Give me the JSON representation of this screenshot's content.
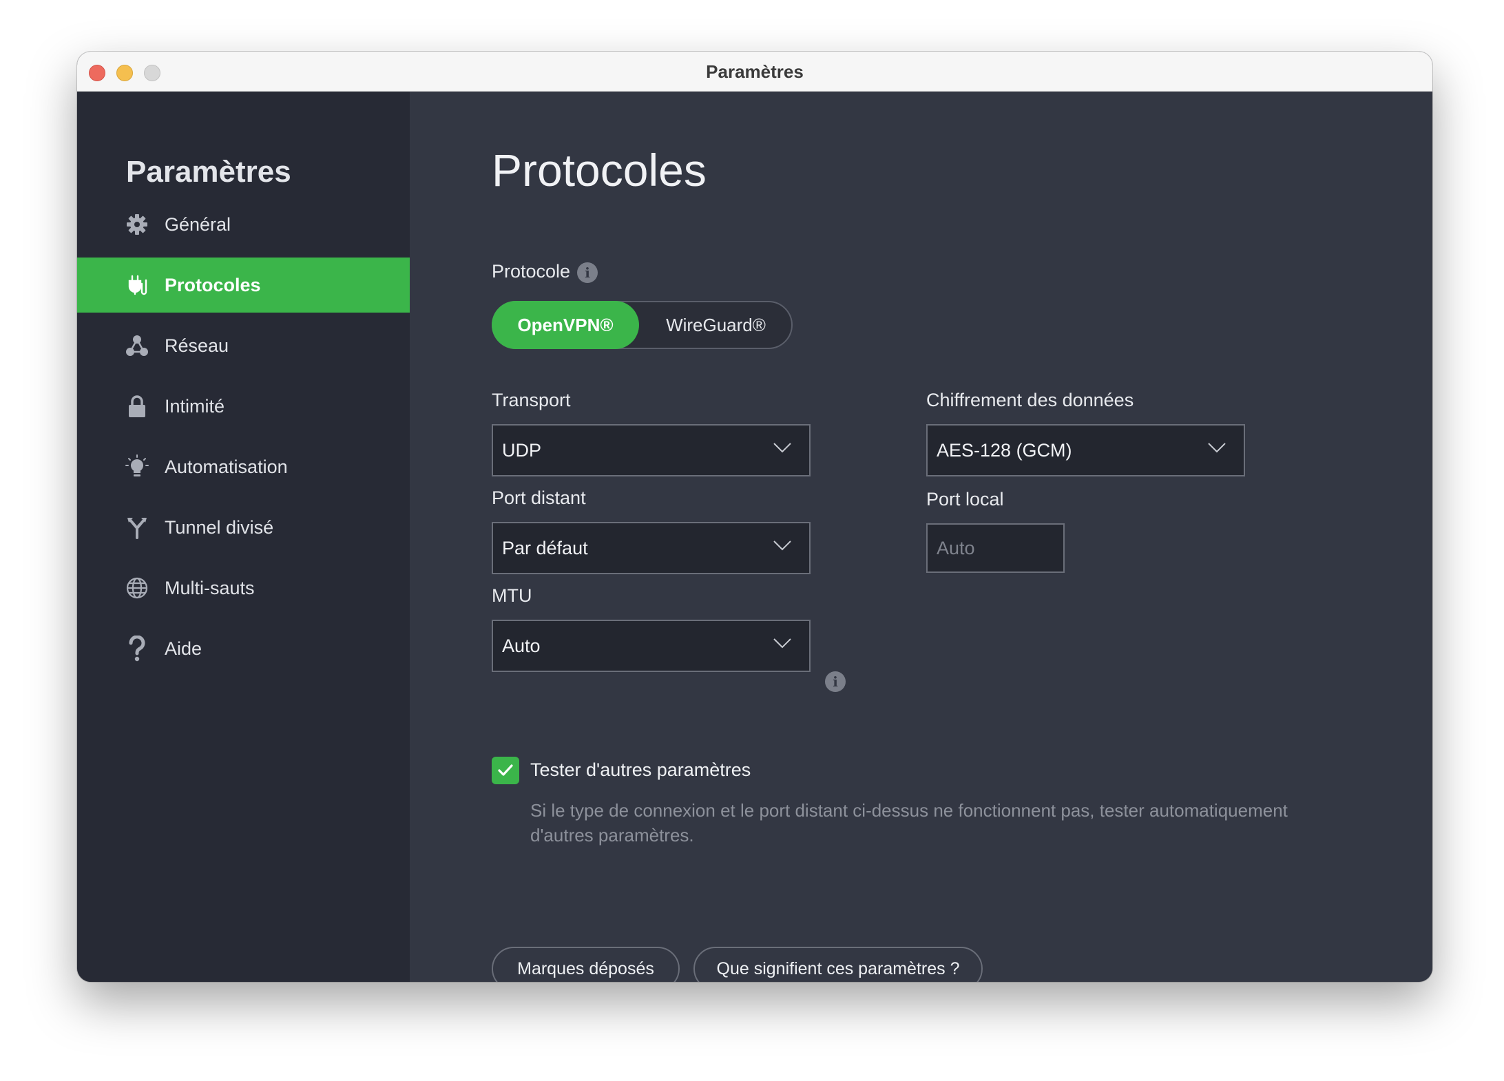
{
  "window": {
    "title": "Paramètres"
  },
  "sidebar": {
    "title": "Paramètres",
    "items": [
      {
        "label": "Général",
        "icon": "gear-icon",
        "active": false
      },
      {
        "label": "Protocoles",
        "icon": "plug-icon",
        "active": true
      },
      {
        "label": "Réseau",
        "icon": "network-icon",
        "active": false
      },
      {
        "label": "Intimité",
        "icon": "lock-icon",
        "active": false
      },
      {
        "label": "Automatisation",
        "icon": "lightbulb-icon",
        "active": false
      },
      {
        "label": "Tunnel divisé",
        "icon": "split-tunnel-icon",
        "active": false
      },
      {
        "label": "Multi-sauts",
        "icon": "globe-icon",
        "active": false
      },
      {
        "label": "Aide",
        "icon": "question-icon",
        "active": false
      }
    ]
  },
  "main": {
    "title": "Protocoles",
    "protocol": {
      "label": "Protocole",
      "options": [
        "OpenVPN®",
        "WireGuard®"
      ],
      "selected": "OpenVPN®"
    },
    "transport": {
      "label": "Transport",
      "value": "UDP"
    },
    "encryption": {
      "label": "Chiffrement des données",
      "value": "AES-128 (GCM)"
    },
    "remote_port": {
      "label": "Port distant",
      "value": "Par défaut"
    },
    "local_port": {
      "label": "Port local",
      "placeholder": "Auto"
    },
    "mtu": {
      "label": "MTU",
      "value": "Auto"
    },
    "try_other": {
      "label": "Tester d'autres paramètres",
      "checked": true,
      "description": "Si le type de connexion et le port distant ci-dessus ne fonctionnent pas, tester automatiquement d'autres paramètres."
    },
    "buttons": {
      "trademarks": "Marques déposés",
      "meaning": "Que signifient ces paramètres ?"
    }
  },
  "colors": {
    "accent": "#3bb54a",
    "sidebar_bg": "#272a35",
    "main_bg": "#333743",
    "field_bg": "#23262f"
  }
}
